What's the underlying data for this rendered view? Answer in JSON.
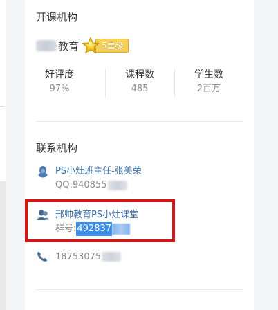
{
  "institution_section": {
    "title": "开课机构",
    "org_name": "教育",
    "level_badge": "5星级",
    "stats": [
      {
        "label": "好评度",
        "value": "97%"
      },
      {
        "label": "课程数",
        "value": "485"
      },
      {
        "label": "学生数",
        "value": "2百万"
      }
    ]
  },
  "contact_section": {
    "title": "联系机构",
    "contacts": [
      {
        "name": "PS小灶班主任-张美荣",
        "sub_prefix": "QQ: ",
        "sub_value": "940855"
      },
      {
        "name": "邢帅教育PS小灶课堂",
        "sub_prefix": "群号: ",
        "sub_value": "492837"
      }
    ],
    "phone": "18753075"
  },
  "colors": {
    "link_blue": "#3b6fa7",
    "highlight_red": "#d81414",
    "selection_blue": "#3d8ee6",
    "badge_gold": "#f3d15b"
  },
  "icons": [
    "star-icon",
    "qq-contact-icon",
    "group-icon",
    "phone-icon"
  ]
}
